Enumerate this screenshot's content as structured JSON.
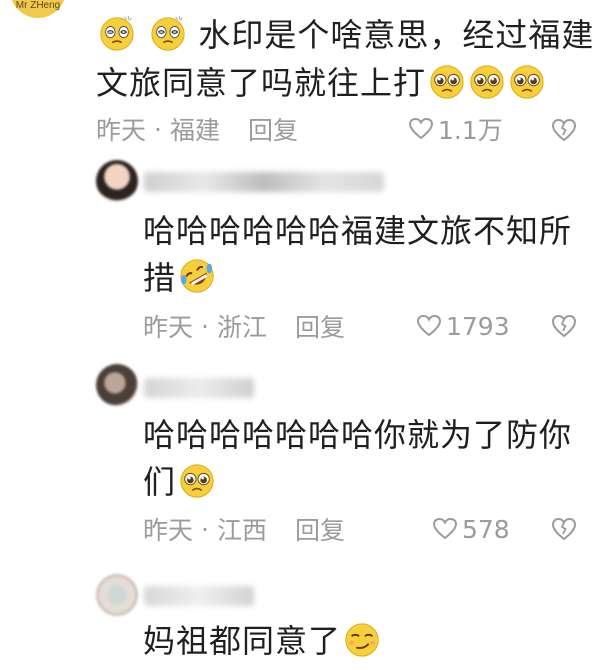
{
  "brand": {
    "text": "Mr ZHeng"
  },
  "comments": [
    {
      "text_line1": "水印是个啥意思，经过福建",
      "text_line2": "文旅同意了吗就往上打",
      "time": "昨天",
      "location": "福建",
      "reply": "回复",
      "likes": "1.1万"
    },
    {
      "text_line1": "哈哈哈哈哈哈福建文旅不知所",
      "text_line2": "措",
      "time": "昨天",
      "location": "浙江",
      "reply": "回复",
      "likes": "1793"
    },
    {
      "text_line1": "哈哈哈哈哈哈哈你就为了防你",
      "text_line2": "们",
      "time": "昨天",
      "location": "江西",
      "reply": "回复",
      "likes": "578"
    },
    {
      "text_line1": "妈祖都同意了"
    }
  ],
  "meta_separator": "·",
  "icons": {
    "heart": "heart-outline-icon",
    "dislike": "broken-heart-icon",
    "emoji_dizzy": "dizzy-face-emoji",
    "emoji_pleading": "pleading-face-emoji",
    "emoji_rofl": "rofl-emoji",
    "emoji_smirk": "smirk-emoji"
  }
}
